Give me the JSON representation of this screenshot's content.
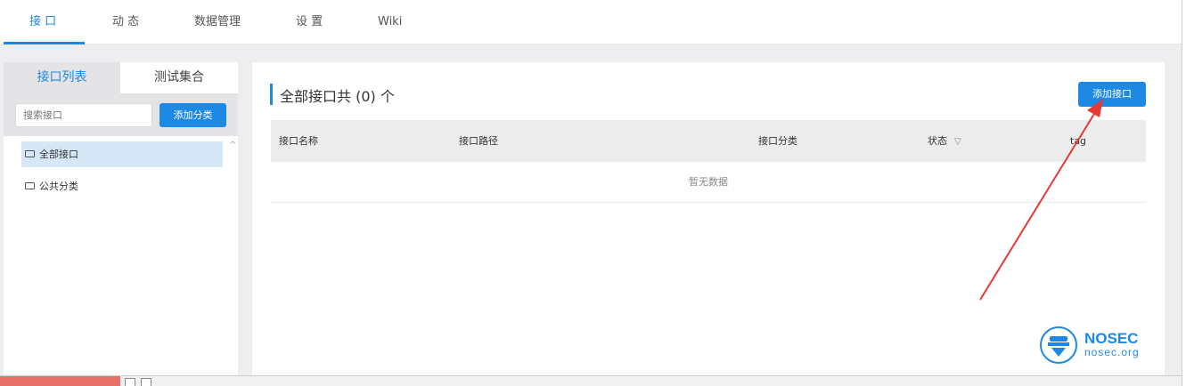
{
  "nav": {
    "tabs": [
      "接 口",
      "动 态",
      "数据管理",
      "设 置",
      "Wiki"
    ]
  },
  "sidebar": {
    "tab_list": "接口列表",
    "tab_collection": "测试集合",
    "search_placeholder": "搜索接口",
    "add_category": "添加分类",
    "tree": [
      {
        "label": "全部接口",
        "active": true
      },
      {
        "label": "公共分类",
        "active": false
      }
    ]
  },
  "main": {
    "title": "全部接口共 (0) 个",
    "add_api": "添加接口",
    "columns": [
      "接口名称",
      "接口路径",
      "接口分类",
      "状态",
      "tag"
    ],
    "empty_text": "暂无数据"
  },
  "watermark": {
    "brand": "NOSEC",
    "url": "nosec.org"
  },
  "colors": {
    "accent": "#1e88e5",
    "arrow": "#e53935"
  }
}
